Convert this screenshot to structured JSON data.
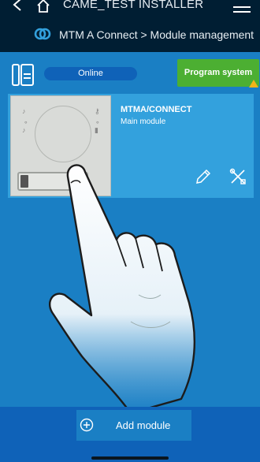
{
  "topbar": {
    "installer_name": "CAME_TEST INSTALLER",
    "breadcrumb": "MTM A Connect > Module management"
  },
  "status": {
    "connection": "Online",
    "program_label": "Program system"
  },
  "module": {
    "name": "MTMA/CONNECT",
    "role": "Main module"
  },
  "footer": {
    "add_label": "Add module"
  },
  "colors": {
    "topbar": "#001e33",
    "content": "#1a7fc4",
    "card": "#33a1dd",
    "pill": "#0f62b8",
    "program": "#4caf32",
    "warning": "#f2b418"
  },
  "icons": [
    "back-icon",
    "home-icon",
    "menu-icon",
    "came-connect-logo-icon",
    "intercom-icon",
    "warning-icon",
    "edit-icon",
    "tools-icon",
    "plus-circle-icon"
  ]
}
